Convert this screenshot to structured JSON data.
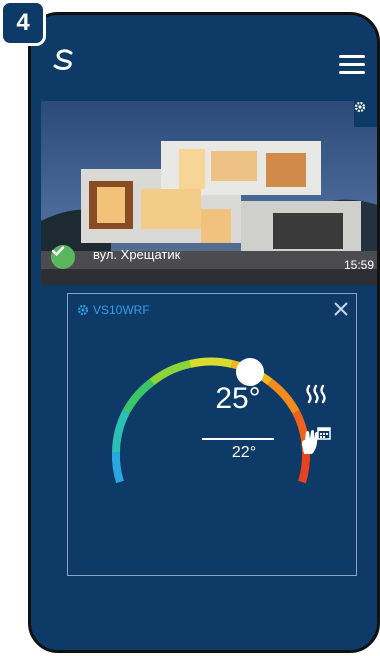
{
  "step": {
    "number": "4"
  },
  "header": {
    "logo_icon": "brand-s-logo-icon",
    "menu_icon": "hamburger-menu-icon"
  },
  "home_card": {
    "address": "вул. Хрещатик",
    "time": "15:59",
    "status": "connected",
    "status_color": "#5ab85c"
  },
  "thermostat": {
    "device_name": "VS10WRF",
    "set_temperature": "25°",
    "current_temperature": "22°",
    "mode": "heating",
    "schedule": "manual",
    "accent": "#2f9fe8"
  },
  "colors": {
    "background": "#0d3a67",
    "card_border": "#8aa5c4"
  }
}
